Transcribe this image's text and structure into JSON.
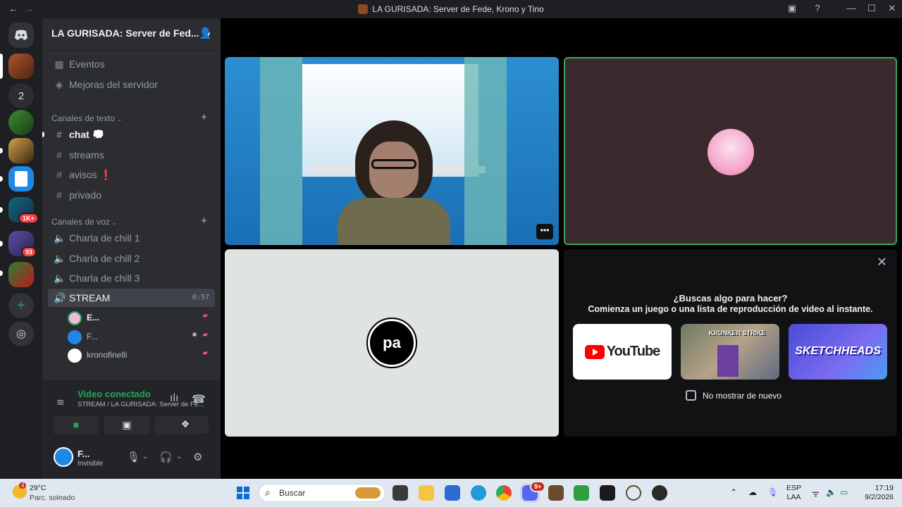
{
  "titlebar": {
    "back": "←",
    "forward": "→",
    "title": "LA GURISADA: Server de Fede, Krono y Tino"
  },
  "servers": {
    "home": "Discord",
    "folder_count": "2",
    "badges": [
      "1K+",
      "93"
    ]
  },
  "server": {
    "name": "LA GURISADA: Server de Fed...",
    "top_items": [
      {
        "icon": "calendar-icon",
        "label": "Eventos"
      },
      {
        "icon": "boost-icon",
        "label": "Mejoras del servidor"
      }
    ],
    "text_category": "Canales de texto",
    "text_channels": [
      {
        "label": "chat",
        "emoji": "💭",
        "unread": true
      },
      {
        "label": "streams",
        "emoji": ""
      },
      {
        "label": "avisos",
        "emoji": "❗"
      },
      {
        "label": "privado",
        "emoji": ""
      }
    ],
    "voice_category": "Canales de voz",
    "voice_channels": [
      {
        "label": "Charla de chill 1"
      },
      {
        "label": "Charla de chill 2"
      },
      {
        "label": "Charla de chill 3"
      },
      {
        "label": "STREAM",
        "active": true,
        "timer": "0:57"
      }
    ],
    "voice_users": [
      {
        "name": "E...",
        "avatar_color": "#f4b9d4"
      },
      {
        "name": "F...",
        "avatar_color": "#1e88e5"
      },
      {
        "name": "kronofinelli",
        "avatar_color": "#ffffff"
      }
    ]
  },
  "voice_panel": {
    "status": "Video conectado",
    "channel": "STREAM / LA GURISADA: Server de Fe..."
  },
  "user_panel": {
    "name": "F...",
    "status": "Invisible"
  },
  "stage": {
    "stream_logo": "pa",
    "activity": {
      "question": "¿Buscas algo para hacer?",
      "subtitle": "Comienza un juego o una lista de reproducción de video al instante.",
      "cards": [
        "YouTube",
        "KRUNKER STRIKE",
        "SKETCHHEADS"
      ],
      "checkbox_label": "No mostrar de nuevo"
    }
  },
  "taskbar": {
    "temp": "29°C",
    "condition": "Parc. soleado",
    "weather_badge": "4",
    "search_placeholder": "Buscar",
    "discord_badge": "9+",
    "lang": "ESP",
    "layout": "LAA",
    "time": "17:19",
    "date": "9/2/2026"
  },
  "colors": {
    "accent_green": "#23a55a",
    "sidebar": "#2b2d31",
    "server_rail": "#1e1f22",
    "danger": "#f23f43"
  }
}
